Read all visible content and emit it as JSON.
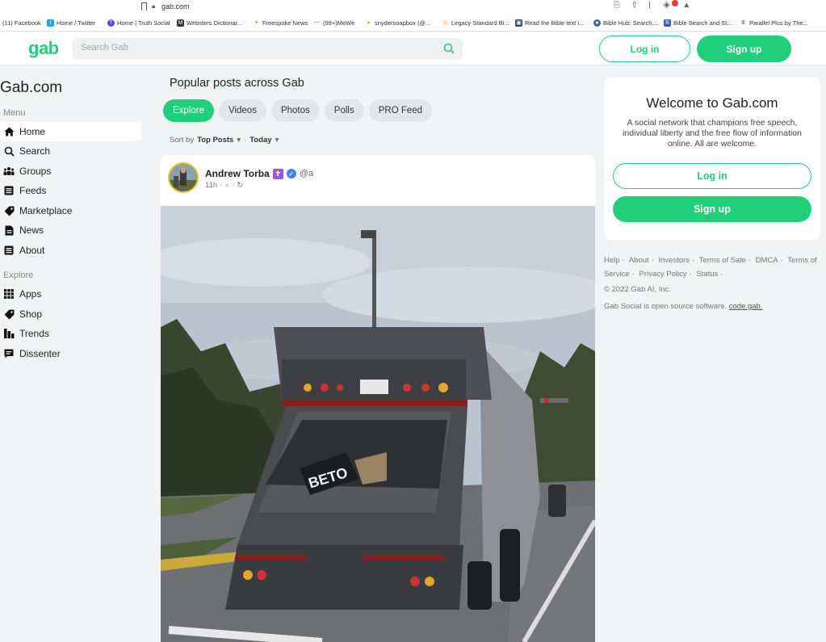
{
  "browser": {
    "url": "gab.com",
    "bookmarks": [
      {
        "label": "(11) Facebook",
        "icon": "facebook-icon",
        "color": "#3b5998"
      },
      {
        "label": "Home / Twitter",
        "icon": "twitter-icon",
        "color": "#1da1f2"
      },
      {
        "label": "Home | Truth Social",
        "icon": "truth-social-icon",
        "color": "#5448ee"
      },
      {
        "label": "Websters Dictionar...",
        "icon": "dictionary-icon",
        "color": "#333333"
      },
      {
        "label": "Freespoke News",
        "icon": "freespoke-icon",
        "color": "#e5a000"
      },
      {
        "label": "(99+)MeWe",
        "icon": "mewe-icon",
        "color": "#444444"
      },
      {
        "label": "snydersoapbox (@...",
        "icon": "bulb-icon",
        "color": "#e0b000"
      },
      {
        "label": "Legacy Standard Bi...",
        "icon": "bible-icon",
        "color": "#e5a04a"
      },
      {
        "label": "Read the Bible text i...",
        "icon": "bible-read-icon",
        "color": "#2d4e6e"
      },
      {
        "label": "Bible Hub: Search,...",
        "icon": "biblehub-icon",
        "color": "#3a6ea5"
      },
      {
        "label": "Bible Search and St...",
        "icon": "bible-search-icon",
        "color": "#3a5ea5"
      },
      {
        "label": "Parallel Plus by The...",
        "icon": "parallel-icon",
        "color": "#666666"
      }
    ]
  },
  "header": {
    "logo": "gab",
    "search_placeholder": "Search Gab",
    "login_label": "Log in",
    "signup_label": "Sign up"
  },
  "sidebar": {
    "site_title": "Gab.com",
    "menu_label": "Menu",
    "menu_items": [
      {
        "label": "Home",
        "icon": "home-icon",
        "active": true
      },
      {
        "label": "Search",
        "icon": "search-icon"
      },
      {
        "label": "Groups",
        "icon": "groups-icon"
      },
      {
        "label": "Feeds",
        "icon": "feeds-icon"
      },
      {
        "label": "Marketplace",
        "icon": "tag-icon"
      },
      {
        "label": "News",
        "icon": "news-icon"
      },
      {
        "label": "About",
        "icon": "about-icon"
      }
    ],
    "explore_label": "Explore",
    "explore_items": [
      {
        "label": "Apps",
        "icon": "apps-icon"
      },
      {
        "label": "Shop",
        "icon": "shop-tag-icon"
      },
      {
        "label": "Trends",
        "icon": "trends-icon"
      },
      {
        "label": "Dissenter",
        "icon": "dissenter-icon"
      }
    ]
  },
  "main": {
    "title": "Popular posts across Gab",
    "tabs": [
      {
        "label": "Explore",
        "active": true
      },
      {
        "label": "Videos"
      },
      {
        "label": "Photos"
      },
      {
        "label": "Polls"
      },
      {
        "label": "PRO Feed"
      }
    ],
    "sort": {
      "prefix": "Sort by",
      "value": "Top Posts",
      "range": "Today"
    },
    "post": {
      "author": "Andrew Torba",
      "handle": "@a",
      "time": "11h",
      "image_sign_text": "BETO"
    }
  },
  "right": {
    "welcome_title": "Welcome to Gab.com",
    "welcome_text": "A social network that champions free speech, individual liberty and the free flow of information online. All are welcome.",
    "login_label": "Log in",
    "signup_label": "Sign up",
    "footer_links": [
      "Help",
      "About",
      "Investors",
      "Terms of Sale",
      "DMCA",
      "Terms of Service",
      "Privacy Policy",
      "Status"
    ],
    "copyright": "© 2022 Gab AI, Inc.",
    "opensource_text": "Gab Social is open source software.",
    "opensource_link": "code.gab."
  },
  "colors": {
    "accent": "#21cf7a",
    "page_bg": "#f2f3f5"
  }
}
